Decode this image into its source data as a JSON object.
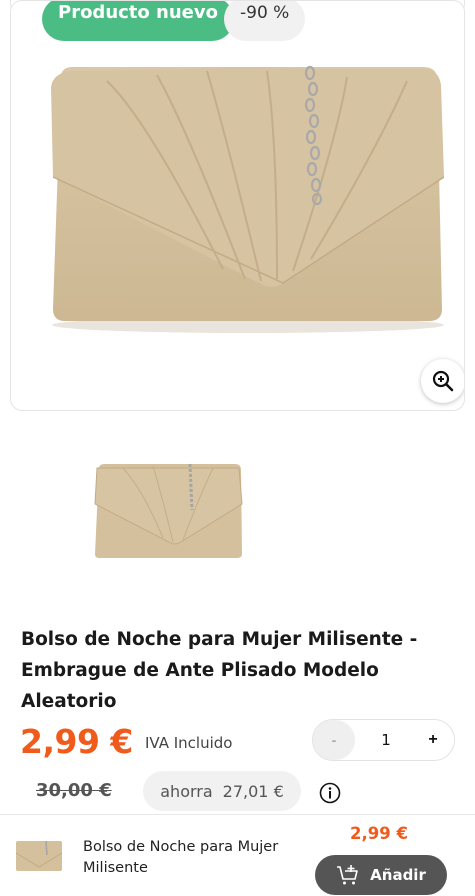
{
  "product": {
    "badges": {
      "new": "Producto nuevo",
      "discount": "-90 %"
    },
    "title": "Bolso de Noche para Mujer Milisente - Embrague de Ante Plisado Modelo Aleatorio",
    "price": "2,99 €",
    "tax_note": "IVA Incluido",
    "old_price": "30,00 €",
    "savings_label": "ahorra",
    "savings_amount": "27,01 €"
  },
  "quantity": {
    "value": "1",
    "minus_label": "-",
    "plus_label": "+"
  },
  "icons": {
    "zoom": "zoom-in-icon",
    "info": "info-icon",
    "cart": "cart-add-icon"
  },
  "bottom_bar": {
    "title": "Bolso de Noche para Mujer Milisente",
    "price": "2,99 €",
    "add_button": "Añadir"
  },
  "colors": {
    "accent_price": "#f05a1a",
    "badge_green": "#4bbd84",
    "add_button_bg": "#555555",
    "bag_suede": "#d2be9a"
  }
}
